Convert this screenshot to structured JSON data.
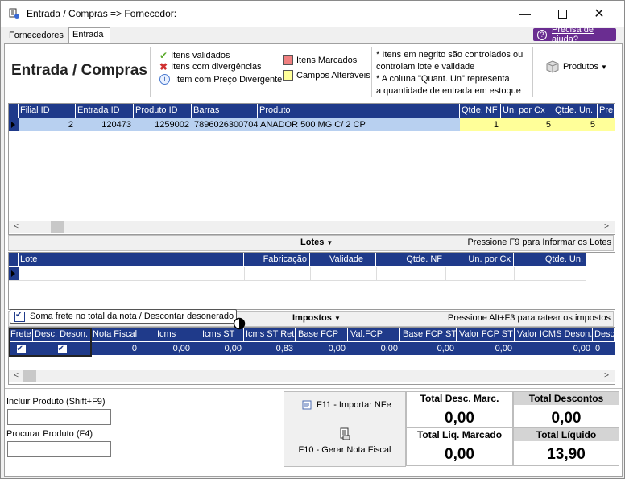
{
  "window": {
    "title": "Entrada / Compras => Fornecedor:"
  },
  "tabs": [
    {
      "label": "Fornecedores"
    },
    {
      "label": "Entrada"
    }
  ],
  "help_label": "Precisa de ajuda?",
  "page_title": "Entrada / Compras",
  "legend": {
    "validated": "Itens validados",
    "divergent": "Itens com divergências",
    "price_divergent": "Item com Preço Divergente",
    "marked": "Itens Marcados",
    "changed": "Campos Alteráveis"
  },
  "notes": {
    "bold": [
      "* Itens em negrito são controlados ou",
      "controlam lote e validade"
    ],
    "quant": [
      "* A coluna \"Quant. Un\" representa",
      "a quantidade de entrada em estoque"
    ]
  },
  "products_button": "Produtos",
  "items_grid": {
    "columns": [
      "Filial ID",
      "Entrada ID",
      "Produto ID",
      "Barras",
      "Produto",
      "Qtde. NF",
      "Un. por Cx",
      "Qtde. Un.",
      "Pre"
    ],
    "row": [
      "2",
      "120473",
      "1259002",
      "7896026300704",
      "ANADOR 500 MG C/ 2 CP",
      "1",
      "5",
      "5",
      ""
    ]
  },
  "lotes": {
    "title": "Lotes",
    "hint": "Pressione F9 para Informar os Lotes",
    "columns": [
      "Lote",
      "Fabricação",
      "Validade",
      "Qtde. NF",
      "Un. por Cx",
      "Qtde. Un."
    ]
  },
  "impostos": {
    "checkbox_label": "Soma frete no total da nota / Descontar desonerado",
    "title": "Impostos",
    "hint": "Pressione Alt+F3 para ratear os impostos",
    "columns": [
      "Frete",
      "Desc. Deson.",
      "Nota Fiscal",
      "Icms",
      "Icms ST",
      "Icms ST Ret",
      "Base FCP",
      "Val.FCP",
      "Base FCP ST",
      "Valor FCP ST",
      "Valor ICMS Deson.",
      "Desc."
    ],
    "row": [
      "",
      "",
      "0",
      "0,00",
      "0,00",
      "0,83",
      "0,00",
      "0,00",
      "0,00",
      "0,00",
      "0,00",
      "0"
    ]
  },
  "include_product": {
    "label": "Incluir Produto (Shift+F9)",
    "value": ""
  },
  "search_product": {
    "label": "Procurar Produto (F4)",
    "value": ""
  },
  "actions": {
    "import_nfe": "F11 - Importar NFe",
    "generate_nf": "F10 - Gerar Nota Fiscal"
  },
  "totals": {
    "desc_marc": {
      "label": "Total Desc. Marc.",
      "value": "0,00"
    },
    "descontos": {
      "label": "Total Descontos",
      "value": "0,00"
    },
    "liq_marcado": {
      "label": "Total Liq. Marcado",
      "value": "0,00"
    },
    "liquido": {
      "label": "Total Líquido",
      "value": "13,90"
    }
  },
  "colors": {
    "header": "#1f3a8a",
    "selected_row": "#b8d0f0",
    "editable": "#ffff99",
    "help": "#6a2d91"
  }
}
